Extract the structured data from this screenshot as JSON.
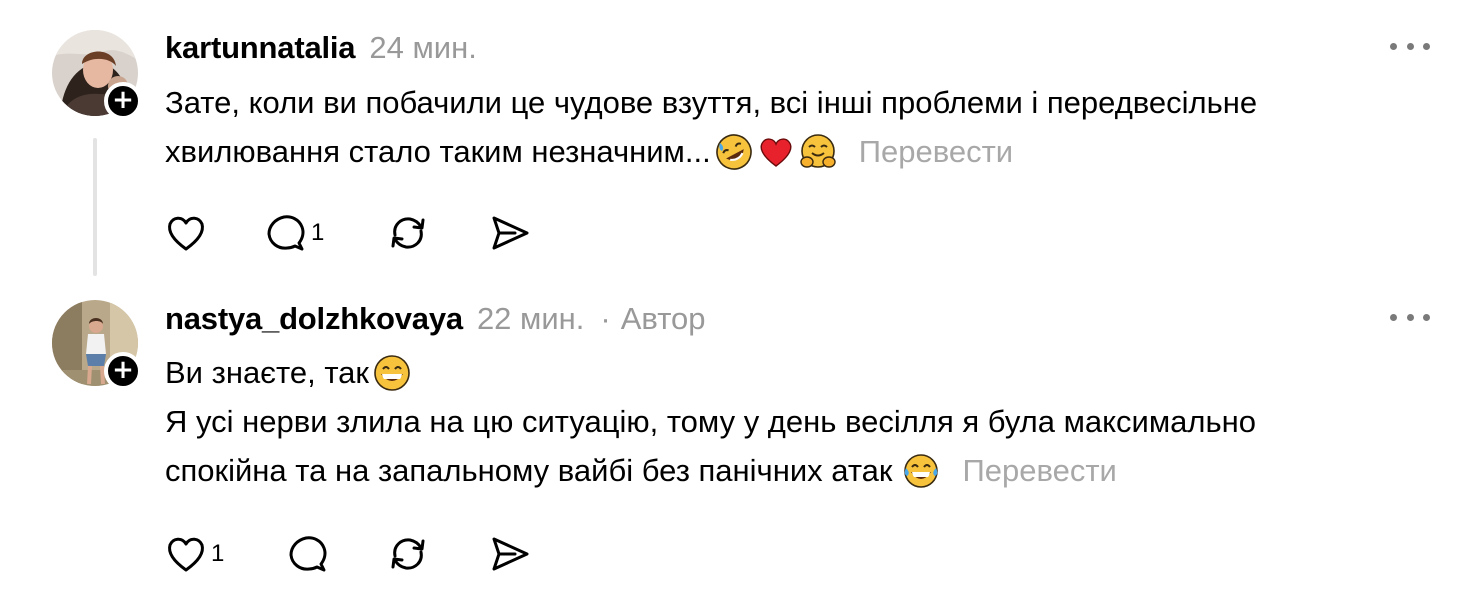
{
  "posts": [
    {
      "username": "kartunnatalia",
      "time": "24 мин.",
      "author_tag": "",
      "lines": [
        "Зате, коли ви побачили це чудове взуття, всі інші проблеми і передвесільне",
        "хвилювання стало таким незначним..."
      ],
      "emojis": [
        "rolling-on-floor-laughing-emoji",
        "red-heart-emoji",
        "hugging-face-emoji"
      ],
      "translate": "Перевести",
      "likes": "",
      "replies": "1"
    },
    {
      "username": "nastya_dolzhkovaya",
      "time": "22 мин.",
      "separator": "·",
      "author_tag": "Автор",
      "lines": [
        "Ви знаєте, так",
        "Я усі нерви злила на цю ситуацію, тому у день весілля я була максимально",
        "спокійна та на запальному вайбі без панічних атак"
      ],
      "emojis": [
        "grinning-face-emoji",
        "tears-of-joy-emoji"
      ],
      "translate": "Перевести",
      "likes": "1",
      "replies": ""
    }
  ],
  "colors": {
    "text": "#000000",
    "muted": "#999999",
    "translate": "#a8a8a8",
    "thread_line": "#e3e3e3",
    "emoji_yellow": "#f7c33c",
    "heart_red": "#e8222d"
  },
  "icons": {
    "like": "heart-outline-icon",
    "reply": "speech-bubble-icon",
    "repost": "repost-arrows-icon",
    "share": "paper-plane-icon",
    "more": "three-dots-icon",
    "follow": "plus-badge-icon"
  }
}
